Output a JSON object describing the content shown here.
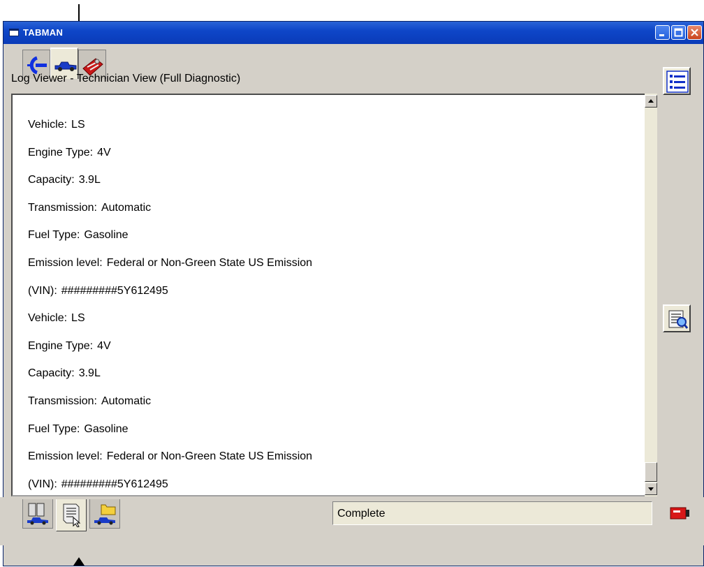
{
  "window": {
    "title": "TABMAN"
  },
  "top_tabs": [
    {
      "icon": "connector-icon"
    },
    {
      "icon": "vehicle-icon",
      "active": true
    },
    {
      "icon": "toolbox-icon"
    }
  ],
  "log": {
    "title": "Log Viewer - Technician View (Full Diagnostic)",
    "lines": [
      {
        "label": "Vehicle:",
        "value": "LS"
      },
      {
        "label": "Engine Type:",
        "value": "4V"
      },
      {
        "label": "Capacity:",
        "value": "3.9L"
      },
      {
        "label": "Transmission:",
        "value": "Automatic"
      },
      {
        "label": "Fuel Type:",
        "value": "Gasoline"
      },
      {
        "label": "Emission level:",
        "value": "Federal or Non-Green State US Emission"
      },
      {
        "label": "(VIN):",
        "value": "#########5Y612495"
      },
      {
        "label": "Vehicle:",
        "value": "LS"
      },
      {
        "label": "Engine Type:",
        "value": "4V"
      },
      {
        "label": "Capacity:",
        "value": "3.9L"
      },
      {
        "label": "Transmission:",
        "value": "Automatic"
      },
      {
        "label": "Fuel Type:",
        "value": "Gasoline"
      },
      {
        "label": "Emission level:",
        "value": "Federal or Non-Green State US Emission"
      },
      {
        "label": "(VIN):",
        "value": "#########5Y612495"
      }
    ]
  },
  "side_buttons": [
    {
      "icon": "list-icon"
    },
    {
      "icon": "log-search-icon"
    }
  ],
  "bottom_tabs": [
    {
      "icon": "vehicle-database-icon"
    },
    {
      "icon": "log-document-icon",
      "active": true
    },
    {
      "icon": "vehicle-folder-icon"
    }
  ],
  "status": {
    "text": "Complete"
  },
  "colors": {
    "titlebar": "#0a3bb8",
    "window_bg": "#d4d0c8",
    "content_bg": "#ffffff"
  }
}
